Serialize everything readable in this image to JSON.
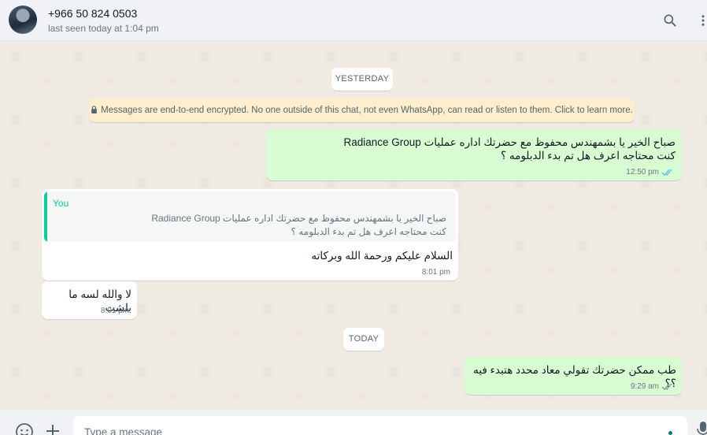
{
  "contact": {
    "name": "+966 50 824 0503",
    "status": "last seen today at 1:04 pm"
  },
  "header_icons": [
    "search-icon",
    "menu-icon"
  ],
  "dates": {
    "yesterday": "YESTERDAY",
    "today": "TODAY"
  },
  "encryption_notice": "Messages are end-to-end encrypted. No one outside of this chat, not even WhatsApp, can read or listen to them. Click to learn more.",
  "messages": [
    {
      "direction": "outgoing",
      "text": "صباح الخير يا بشمهندس محفوظ مع حضرتك اداره عمليات Radiance Group\nكنت محتاجه اعرف هل تم بدء الدبلومه  ؟",
      "time": "12:50 pm",
      "status": "read"
    },
    {
      "direction": "incoming",
      "quoted": {
        "author": "You",
        "text": "صباح الخير يا بشمهندس محفوظ مع حضرتك اداره عمليات Radiance Group\nكنت محتاجه اعرف هل تم بدء الدبلومه  ؟"
      },
      "text": "السلام عليكم ورحمة الله وبركاته",
      "time": "8:01 pm"
    },
    {
      "direction": "incoming",
      "text": "لا والله لسه ما بلشت",
      "time": "8:01 pm"
    },
    {
      "direction": "outgoing",
      "text": "طب ممكن حضرتك تقولي معاد محدد هتبدء فيه ؟؟",
      "time": "9:29 am",
      "status": "delivered"
    }
  ],
  "composer": {
    "placeholder": "Type a message",
    "value": ""
  },
  "colors": {
    "outgoing_bubble": "#d9fdd3",
    "incoming_bubble": "#ffffff",
    "quote_accent": "#06cf9c",
    "read_ticks": "#53bdeb",
    "delivered_ticks": "#8696a0",
    "encryption_bg": "#ffeecd"
  }
}
